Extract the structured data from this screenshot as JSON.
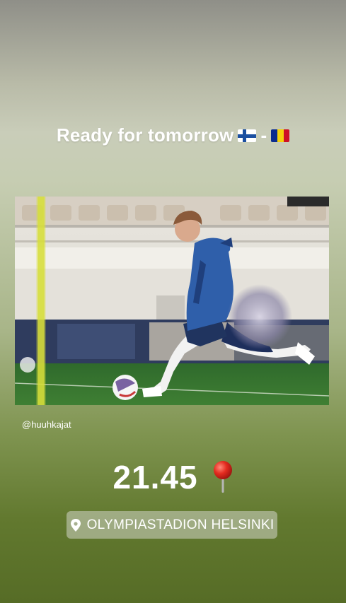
{
  "story": {
    "caption": "Ready for tomorrow",
    "caption_separator": "-",
    "flags": [
      {
        "icon": "finland-flag-icon",
        "colors": [
          "#ffffff",
          "#1a4fa0"
        ]
      },
      {
        "icon": "romania-flag-icon",
        "colors": [
          "#0b2c8f",
          "#f5d20c",
          "#ce1126"
        ]
      }
    ],
    "photo_credit": "@huuhkajat",
    "kickoff_time": "21.45",
    "time_sticker_icon": "red-pushpin-icon",
    "location_sticker": {
      "icon": "location-pin-icon",
      "label": "OLYMPIASTADION HELSINKI"
    }
  }
}
